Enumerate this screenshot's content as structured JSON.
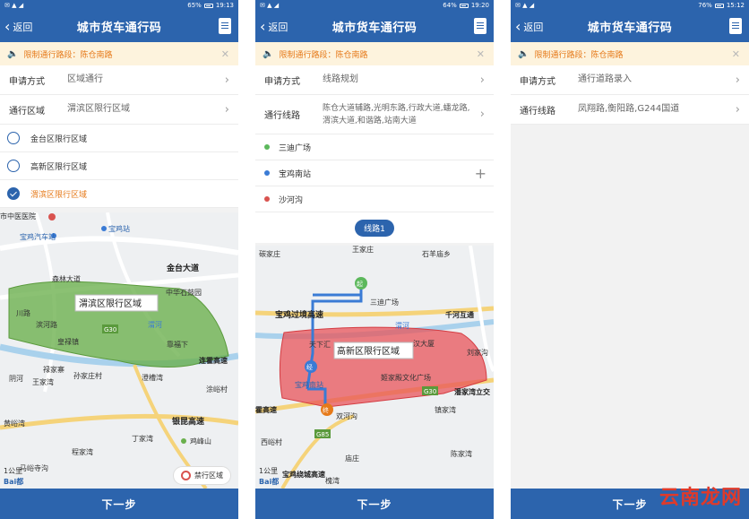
{
  "screens": [
    {
      "status": {
        "left": "✉ ▲ ◢",
        "battery": "65%",
        "time": "19:13"
      },
      "nav": {
        "back": "返回",
        "title": "城市货车通行码"
      },
      "notice": "限制通行路段：陈仓南路",
      "rows": [
        {
          "label": "申请方式",
          "value": "区域通行"
        },
        {
          "label": "通行区域",
          "value": "渭滨区限行区域"
        }
      ],
      "options": [
        {
          "label": "金台区限行区域",
          "selected": false
        },
        {
          "label": "高新区限行区域",
          "selected": false
        },
        {
          "label": "渭滨区限行区域",
          "selected": true
        }
      ],
      "map": {
        "zone_label": "渭滨区限行区域",
        "places": [
          "市中医医院",
          "宝鸡汽车站",
          "宝鸡站",
          "金台大道",
          "森林大道",
          "中华石鼓园",
          "渭滨区限行区域",
          "滨河路",
          "川路",
          "渭河",
          "皇禄镇",
          "靠福下",
          "连霍高速",
          "禄家寨",
          "阴河",
          "王家湾",
          "孙家庄村",
          "澄槽湾",
          "涂峪村",
          "黄峪湾",
          "银昆高速",
          "丁家湾",
          "鸡峰山",
          "程家湾",
          "马峪寺沟",
          "G30"
        ],
        "scale": "1公里",
        "banned_label": "禁行区域"
      },
      "next": "下一步"
    },
    {
      "status": {
        "left": "✉ ▲ ◢",
        "battery": "64%",
        "time": "19:20"
      },
      "nav": {
        "back": "返回",
        "title": "城市货车通行码"
      },
      "notice": "限制通行路段：陈仓南路",
      "rows": [
        {
          "label": "申请方式",
          "value": "线路规划"
        },
        {
          "label": "通行线路",
          "value": "陈仓大道辅路,光明东路,行政大道,蟠龙路,渭滨大道,和谐路,站南大道"
        }
      ],
      "stops": [
        {
          "label": "三迪广场",
          "color": "#5cb85c"
        },
        {
          "label": "宝鸡南站",
          "color": "#3a7bd5"
        },
        {
          "label": "沙河沟",
          "color": "#d9534f"
        }
      ],
      "route_tab": "线路1",
      "map": {
        "zone_label": "高新区限行区域",
        "places": [
          "王家庄",
          "石羊庙乡",
          "碳家庄",
          "三迪广场",
          "宝鸡过境高速",
          "千河互通",
          "渭河",
          "天下汇",
          "汉大厦",
          "刘家沟",
          "宝鸡南站",
          "姬家殿文化广场",
          "潘家湾立交",
          "双河沟",
          "霍高速",
          "镇家湾",
          "西峪村",
          "宝鸡绕城高速",
          "庙庄",
          "陈家湾",
          "槐湾",
          "G30",
          "G85"
        ],
        "markers": {
          "start": "起",
          "mid": "经",
          "end": "终"
        },
        "scale": "1公里"
      },
      "next": "下一步"
    },
    {
      "status": {
        "left": "✉ ▲ ◢",
        "battery": "76%",
        "time": "15:12"
      },
      "nav": {
        "back": "返回",
        "title": "城市货车通行码"
      },
      "notice": "限制通行路段：陈仓南路",
      "rows": [
        {
          "label": "申请方式",
          "value": "通行道路录入"
        },
        {
          "label": "通行线路",
          "value": "凤翔路,衡阳路,G244国道"
        }
      ],
      "next": "下一步",
      "watermark": "云南龙网"
    }
  ],
  "colors": {
    "primary": "#2c64ad",
    "warning": "#e67a1a",
    "notice_bg": "#fdf3dd",
    "zone_green": "#6ab04c",
    "zone_red": "#e8545a"
  }
}
